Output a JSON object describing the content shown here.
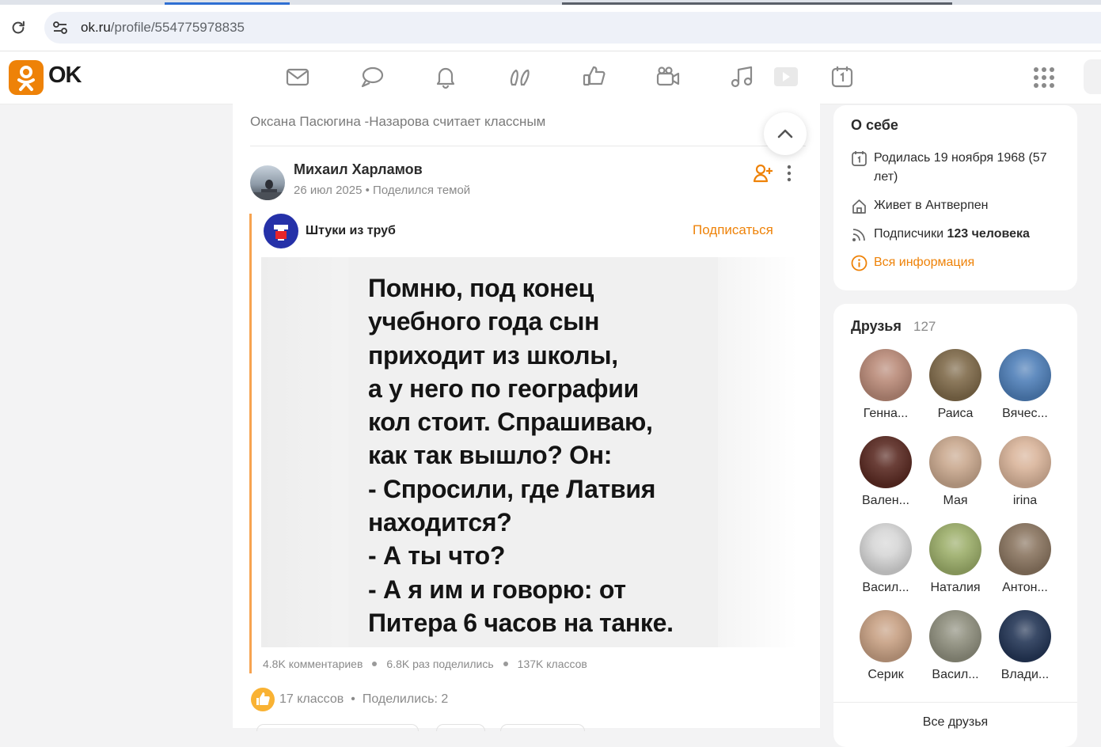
{
  "browser": {
    "url_host": "ok.ru",
    "url_path": "/profile/554775978835"
  },
  "header": {
    "logo_text": "OK",
    "nav_icons": [
      "mail-icon",
      "chat-icon",
      "bell-icon",
      "guests-icon",
      "like-icon",
      "video-icon",
      "music-icon",
      "play-icon",
      "calendar-icon"
    ],
    "apps_icon": "apps-grid-icon",
    "brand_color": "#ee8208"
  },
  "feed": {
    "liked_note": "Оксана Пасюгина -Назарова считает классным",
    "author": {
      "name": "Михаил Харламов",
      "date": "26 июл 2025",
      "action": "Поделился темой"
    },
    "group": {
      "name": "Штуки из труб",
      "subscribe_label": "Подписаться"
    },
    "post_text_lines": [
      "Помню, под конец",
      "учебного года сын",
      "приходит из школы,",
      "а у него по географии",
      "кол стоит. Спрашиваю,",
      "как так вышло? Он:",
      "- Спросили, где Латвия",
      "находится?",
      "- А ты что?",
      "- А я им и говорю: от",
      "Питера 6 часов на танке."
    ],
    "stats": {
      "comments": "4.8K комментариев",
      "shares": "6.8K раз поделились",
      "likes": "137K классов"
    },
    "reactions": {
      "likes": "17 классов",
      "shared": "Поделились: 2"
    }
  },
  "about": {
    "title": "О себе",
    "birth": "Родилась 19 ноября 1968 (57 лет)",
    "lives_prefix": "Живет в ",
    "city": "Антверпен",
    "subs_prefix": "Подписчики ",
    "subs_count": "123 человека",
    "all_info": "Вся информация"
  },
  "friends": {
    "title": "Друзья",
    "count": "127",
    "items": [
      {
        "name": "Генна...",
        "color": "#b98a78"
      },
      {
        "name": "Раиса",
        "color": "#7f6a4a"
      },
      {
        "name": "Вячес...",
        "color": "#4f7fb8"
      },
      {
        "name": "Вален...",
        "color": "#5a2a22"
      },
      {
        "name": "Мая",
        "color": "#c9a88e"
      },
      {
        "name": "irina",
        "color": "#d9b49a"
      },
      {
        "name": "Васил...",
        "color": "#d6d6d6"
      },
      {
        "name": "Наталия",
        "color": "#9cae6a"
      },
      {
        "name": "Антон...",
        "color": "#8a7560"
      },
      {
        "name": "Серик",
        "color": "#c7a083"
      },
      {
        "name": "Васил...",
        "color": "#8f8f7e"
      },
      {
        "name": "Влади...",
        "color": "#243656"
      }
    ],
    "all_label": "Все друзья"
  }
}
